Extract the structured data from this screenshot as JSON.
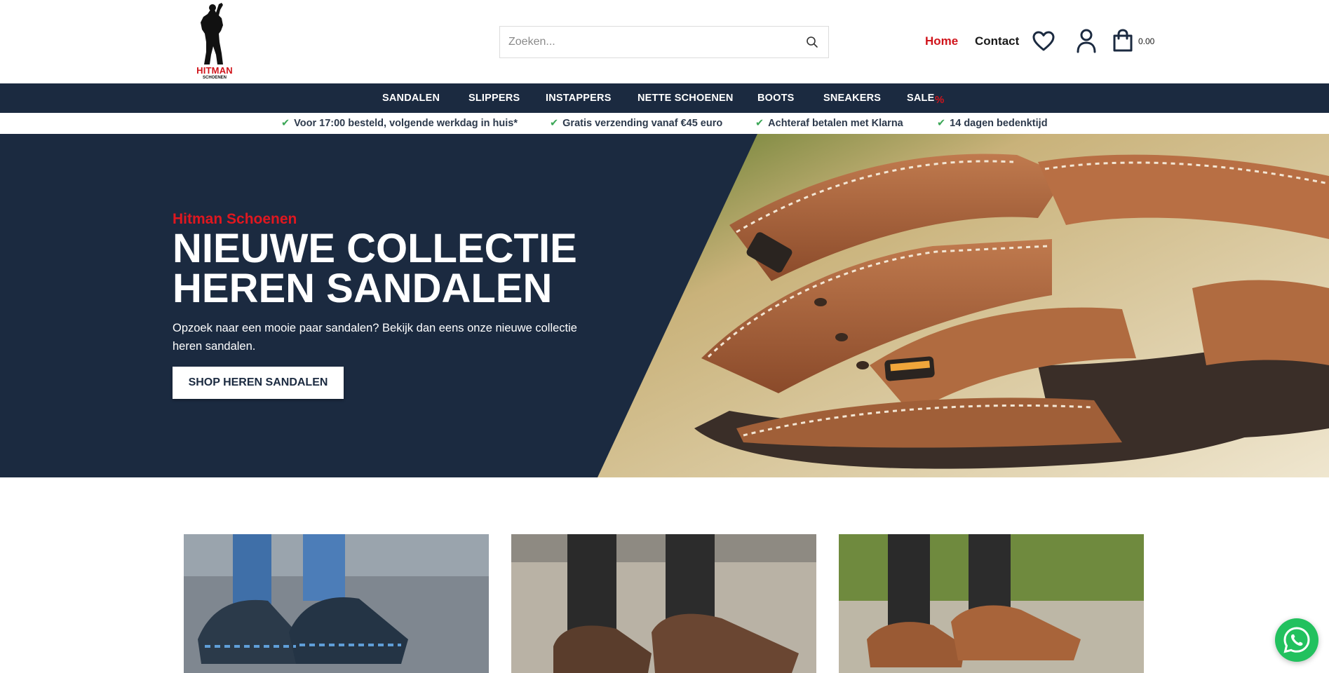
{
  "brand": {
    "name": "HITMAN",
    "sub": "SCHOENEN"
  },
  "search": {
    "placeholder": "Zoeken..."
  },
  "header": {
    "home_label": "Home",
    "contact_label": "Contact",
    "cart_total": "0.00",
    "icons": [
      "search-icon",
      "heart-icon",
      "user-icon",
      "cart-icon"
    ]
  },
  "categories": [
    {
      "label": "SANDALEN"
    },
    {
      "label": "SLIPPERS"
    },
    {
      "label": "INSTAPPERS"
    },
    {
      "label": "NETTE SCHOENEN"
    },
    {
      "label": "BOOTS"
    },
    {
      "label": "SNEAKERS"
    },
    {
      "label": "SALE"
    }
  ],
  "usps": [
    {
      "text": "Voor 17:00 besteld, volgende werkdag in huis*"
    },
    {
      "text": "Gratis verzending vanaf €45 euro"
    },
    {
      "text": "Achteraf betalen met Klarna"
    },
    {
      "text": "14 dagen bedenktijd"
    }
  ],
  "hero": {
    "kicker": "Hitman Schoenen",
    "title_line1": "NIEUWE COLLECTIE",
    "title_line2": "HEREN SANDALEN",
    "text": "Opzoek naar een mooie paar sandalen? Bekijk dan eens onze nieuwe collectie heren sandalen.",
    "button": "SHOP HEREN SANDALEN"
  },
  "colors": {
    "navy": "#1b2a40",
    "accent_red": "#d0141b",
    "check_green": "#3aa655",
    "whatsapp_green": "#22c15e"
  }
}
